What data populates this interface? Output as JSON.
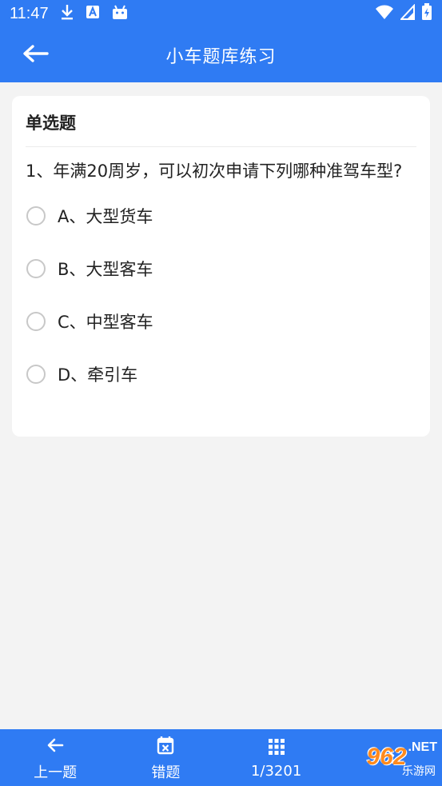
{
  "status_bar": {
    "time": "11:47",
    "icons": [
      "download-icon",
      "a-icon",
      "android-icon",
      "wifi-icon",
      "signal-icon",
      "battery-icon"
    ]
  },
  "app_bar": {
    "title": "小车题库练习",
    "back_icon": "arrow-left-icon"
  },
  "question": {
    "type": "单选题",
    "text": "1、年满20周岁，可以初次申请下列哪种准驾车型?",
    "options": [
      {
        "label": "A、大型货车"
      },
      {
        "label": "B、大型客车"
      },
      {
        "label": "C、中型客车"
      },
      {
        "label": "D、牵引车"
      }
    ]
  },
  "bottom_bar": {
    "prev_label": "上一题",
    "wrong_label": "错题",
    "progress_label": "1/3201"
  },
  "watermark": {
    "number": "962",
    "domain": ".NET",
    "sub": "乐游网"
  },
  "colors": {
    "primary": "#2f7bf3",
    "background": "#f3f3f3",
    "card": "#ffffff"
  }
}
